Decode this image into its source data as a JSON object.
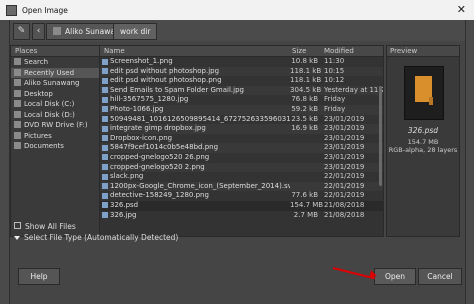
{
  "window": {
    "title": "Open Image"
  },
  "toolbar": {
    "breadcrumbs": [
      "Aliko Sunawang",
      "work dir"
    ]
  },
  "places": {
    "header": "Places",
    "items": [
      "Search",
      "Recently Used",
      "Aliko Sunawang",
      "Desktop",
      "Local Disk (C:)",
      "Local Disk (D:)",
      "DVD RW Drive (F:)",
      "Pictures",
      "Documents"
    ],
    "add_symbol": "+",
    "remove_symbol": "−"
  },
  "filelist": {
    "headers": {
      "name": "Name",
      "size": "Size",
      "modified": "Modified"
    },
    "rows": [
      {
        "name": "Screenshot_1.png",
        "size": "10.8 kB",
        "modified": "11:30"
      },
      {
        "name": "edit psd without photoshop.jpg",
        "size": "118.1 kB",
        "modified": "10:15"
      },
      {
        "name": "edit psd without photoshop.png",
        "size": "118.1 kB",
        "modified": "10:12"
      },
      {
        "name": "Send Emails to Spam Folder Gmail.jpg",
        "size": "304.5 kB",
        "modified": "Yesterday at 11:22"
      },
      {
        "name": "hill-3567575_1280.jpg",
        "size": "76.8 kB",
        "modified": "Friday"
      },
      {
        "name": "Photo-1066.jpg",
        "size": "59.2 kB",
        "modified": "Friday"
      },
      {
        "name": "50949481_1016126509895414_672752633596031795...",
        "size": "23.5 kB",
        "modified": "23/01/2019"
      },
      {
        "name": "integrate gimp dropbox.jpg",
        "size": "16.9 kB",
        "modified": "23/01/2019"
      },
      {
        "name": "Dropbox-icon.png",
        "size": "",
        "modified": "23/01/2019"
      },
      {
        "name": "5847f9cef1014c0b5e48bd.png",
        "size": "",
        "modified": "23/01/2019"
      },
      {
        "name": "cropped-gnelogo520 26.png",
        "size": "",
        "modified": "23/01/2019"
      },
      {
        "name": "cropped-gnelogo520 2.png",
        "size": "",
        "modified": "23/01/2019"
      },
      {
        "name": "slack.png",
        "size": "",
        "modified": "22/01/2019"
      },
      {
        "name": "1200px-Google_Chrome_icon_(September_2014).svg.png",
        "size": "",
        "modified": "22/01/2019"
      },
      {
        "name": "detective-158249_1280.png",
        "size": "77.6 kB",
        "modified": "22/01/2019"
      },
      {
        "name": "326.psd",
        "size": "154.7 MB",
        "modified": "21/08/2018"
      },
      {
        "name": "326.jpg",
        "size": "2.7 MB",
        "modified": "21/08/2018"
      }
    ],
    "selected_index": 15
  },
  "preview": {
    "header": "Preview",
    "filename": "326.psd",
    "size": "154.7 MB",
    "type": "RGB-alpha, 28 layers"
  },
  "options": {
    "show_all_files": "Show All Files",
    "file_type": "Select File Type (Automatically Detected)"
  },
  "buttons": {
    "help": "Help",
    "open": "Open",
    "cancel": "Cancel"
  },
  "icons": {
    "close": "✕",
    "edit": "✎",
    "back": "‹"
  },
  "colors": {
    "annotation_arrow": "#dd0000",
    "thumbnail_book": "#d9902c"
  }
}
